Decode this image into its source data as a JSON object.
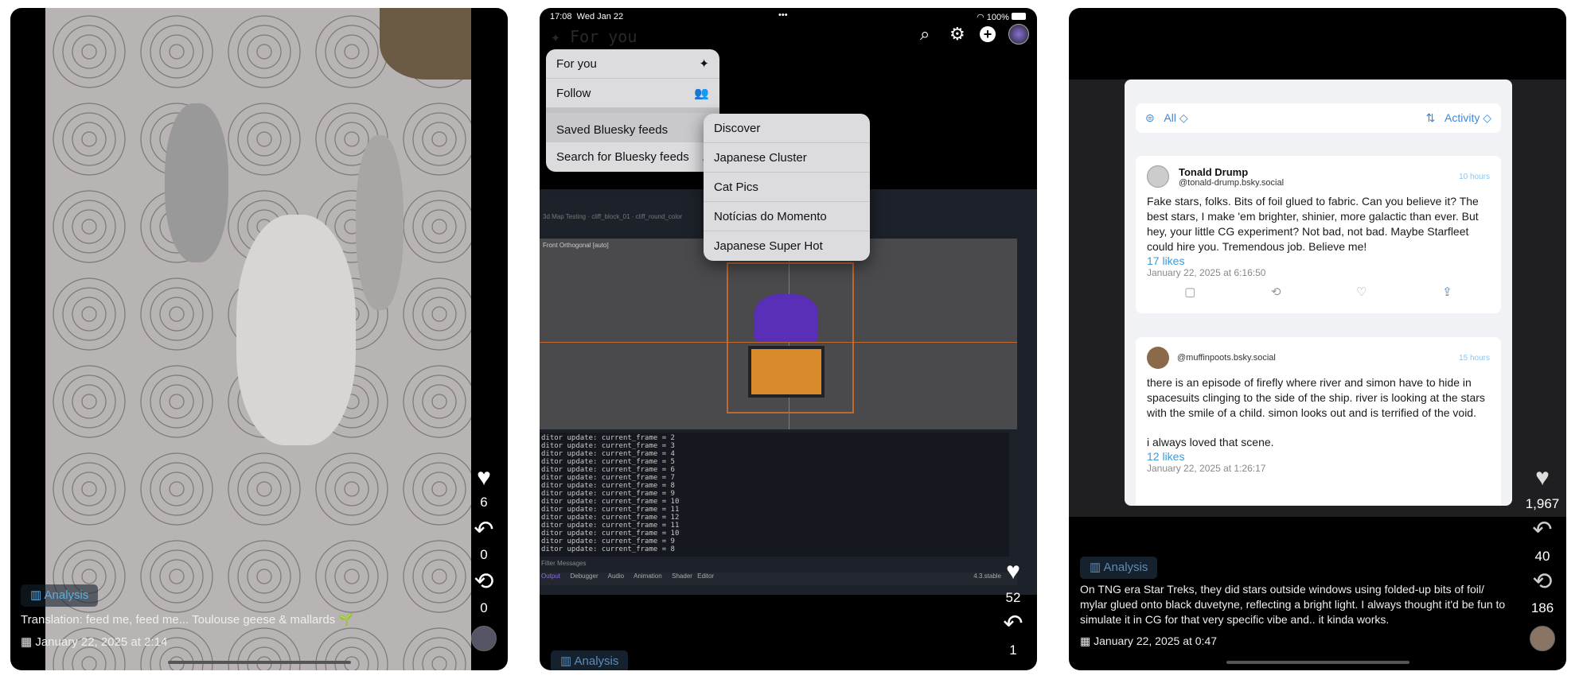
{
  "left": {
    "chip_label": "Analysis",
    "caption": "Translation: feed me, feed me... Toulouse geese & mallards 🌱",
    "date": "January 22, 2025 at 2:14",
    "likes": "6",
    "replies": "0",
    "reposts": "0"
  },
  "middle": {
    "status": {
      "time": "17:08",
      "date": "Wed Jan 22",
      "dots": "•••",
      "battery": "100%"
    },
    "header_title": "For you",
    "menu": [
      {
        "label": "For you",
        "icon": "✦"
      },
      {
        "label": "Follow",
        "icon": "👥"
      },
      {
        "label": "Saved Bluesky feeds",
        "icon": ""
      },
      {
        "label": "Search for Bluesky feeds",
        "icon": "⌕"
      }
    ],
    "submenu": [
      "Discover",
      "Japanese Cluster",
      "Cat Pics",
      "Notícias do Momento",
      "Japanese Super Hot"
    ],
    "editor": {
      "tabs": [
        "3d Map Testing",
        "cliff_block_01",
        "cliff_round_color"
      ],
      "viewport_label": "Front Orthogonal [auto]",
      "log_lines": [
        "ditor update: current_frame = 2",
        "ditor update: current_frame = 3",
        "ditor update: current_frame = 4",
        "ditor update: current_frame = 5",
        "ditor update: current_frame = 6",
        "ditor update: current_frame = 7",
        "ditor update: current_frame = 8",
        "ditor update: current_frame = 9",
        "ditor update: current_frame = 10",
        "ditor update: current_frame = 11",
        "ditor update: current_frame = 12",
        "ditor update: current_frame = 11",
        "ditor update: current_frame = 10",
        "ditor update: current_frame = 9",
        "ditor update: current_frame = 8"
      ],
      "filter_placeholder": "Filter Messages",
      "bottom_tabs": [
        "Output",
        "Debugger",
        "Audio",
        "Animation",
        "Shader Editor"
      ],
      "version": "4.3.stable"
    },
    "chip_label": "Analysis",
    "likes": "52",
    "replies": "1"
  },
  "right": {
    "filter": {
      "all_label": "All ◇",
      "sort_label": "Activity ◇"
    },
    "posts": [
      {
        "name": "Tonald Drump",
        "handle": "@tonald-drump.bsky.social",
        "time": "10 hours",
        "text": "Fake stars, folks. Bits of foil glued to fabric. Can you believe it? The best stars, I make 'em brighter, shinier, more galactic than ever. But hey, your little CG experiment? Not bad, not bad. Maybe Starfleet could hire you. Tremendous job. Believe me!",
        "likes": "17  likes",
        "date": "January 22, 2025 at 6:16:50"
      },
      {
        "name": "",
        "handle": "@muffinpoots.bsky.social",
        "time": "15 hours",
        "text": "there is an episode of firefly where river and simon have to hide in spacesuits clinging to the side of the ship. river is looking at the stars with the smile of a child. simon looks out and is terrified of the void.",
        "text2": "i always loved that scene.",
        "likes": "12  likes",
        "date": "January 22, 2025 at 1:26:17"
      }
    ],
    "chip_label": "Analysis",
    "caption": "On TNG era Star Treks, they did stars outside windows using folded-up bits of foil/ mylar glued onto black duvetyne, reflecting a bright light. I always thought it'd be fun to simulate it in CG for that very specific vibe and.. it kinda works.",
    "date": "January 22, 2025 at 0:47",
    "likes": "1,967",
    "replies": "40",
    "reposts": "186"
  },
  "colors": {
    "chip_text": "#5d8db8",
    "chip_bg": "#16212e",
    "link_blue": "#3b9ad9",
    "panel_bg": "#000000"
  }
}
